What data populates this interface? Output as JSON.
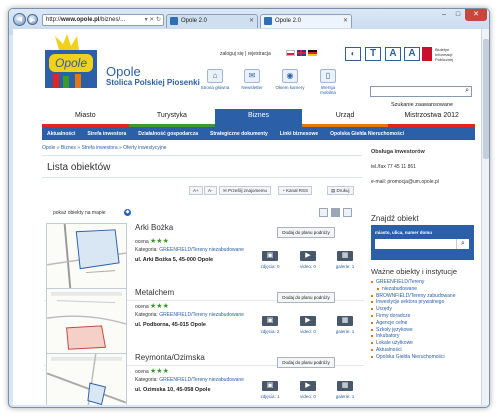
{
  "browser": {
    "url_prefix": "http://",
    "url_host": "www.opole.pl",
    "url_rest": "/biznes/...",
    "tabs": [
      {
        "label": "Opole 2.0"
      },
      {
        "label": "Opole 2.0"
      }
    ]
  },
  "header": {
    "logo_text": "Opole",
    "title": "Opole",
    "subtitle": "Stolica Polskiej Piosenki",
    "login_link": "zaloguj się | rejestracja",
    "quick_links": [
      {
        "label": "Strona główna",
        "icon": "home-icon"
      },
      {
        "label": "Newsletter",
        "icon": "mail-icon"
      },
      {
        "label": "Okiem kamery",
        "icon": "camera-icon"
      },
      {
        "label": "Wersja mobilna",
        "icon": "mobile-icon"
      }
    ],
    "text_size_buttons": [
      "T",
      "A",
      "A"
    ],
    "bip_text": "Biuletyn\nInformacji\nPublicznej",
    "search_placeholder": "",
    "advanced_search": "Szukanie zaawansowane"
  },
  "menu": {
    "items": [
      {
        "label": "Miasto",
        "color": "#e2261c"
      },
      {
        "label": "Turystyka",
        "color": "#3a9a2a"
      },
      {
        "label": "Biznes",
        "color": "#2b5fa8"
      },
      {
        "label": "Urząd",
        "color": "#e07a10"
      },
      {
        "label": "Mistrzostwa 2012",
        "color": "#e2261c"
      }
    ],
    "active_index": 2
  },
  "submenu": {
    "items": [
      "Aktualności",
      "Strefa inwestora",
      "Działalność gospodarcza",
      "Strategiczne dokumenty",
      "Linki biznesowe",
      "Opolska Giełda Nieruchomości"
    ]
  },
  "breadcrumb": "Opole » Biznes » Strefa inwestora » Oferty inwestycyjne",
  "main": {
    "title": "Lista obiektów",
    "toolbar": {
      "font_plus": "A+",
      "font_minus": "A-",
      "share": "Prześlij znajomemu",
      "rss": "Kanał RSS",
      "print": "Drukuj"
    },
    "show_on_map": "pokaż obiekty na mapie",
    "items": [
      {
        "name": "Arki Bożka",
        "rating_label": "ocena",
        "stars": "★★★",
        "category_label": "Kategoria:",
        "category": "GREENFIELD/Tereny niezabudowane",
        "address": "ul. Arki Bożka 5, 45-000 Opole",
        "plan_button": "Dodaj do planu podróży",
        "photos": "zdjęcia: 0",
        "video": "video: 0",
        "gallery": "galerie: 1"
      },
      {
        "name": "Metalchem",
        "rating_label": "ocena",
        "stars": "★★★",
        "category_label": "Kategoria:",
        "category": "GREENFIELD/Tereny niezabudowane",
        "address": "ul. Podborna, 45-015 Opole",
        "plan_button": "Dodaj do planu podróży",
        "photos": "zdjęcia: 2",
        "video": "video: 0",
        "gallery": "galerie: 1"
      },
      {
        "name": "Reymonta/Ozimska",
        "rating_label": "ocena",
        "stars": "★★★",
        "category_label": "Kategoria:",
        "category": "GREENFIELD/Tereny niezabudowane",
        "address": "ul. Ozimska 10, 45-058 Opole",
        "plan_button": "Dodaj do planu podróży",
        "photos": "zdjęcia: 1",
        "video": "video: 0",
        "gallery": "galerie: 1"
      }
    ]
  },
  "sidebar": {
    "service_title": "Obsługa inwestorów",
    "phone": "tel./fax 77 45 11 861",
    "email": "e-mail: promocja@um.opole.pl",
    "find_title": "Znajdź obiekt",
    "find_label": "miasto, ulica, numer domu",
    "important_title": "Ważne obiekty i instytucje",
    "links": [
      {
        "label": "GREENFIELD/Tereny",
        "indent": false
      },
      {
        "label": "niezabudowane",
        "indent": true
      },
      {
        "label": "BROWNFIELD/Tereny zabudowane",
        "indent": false
      },
      {
        "label": "Inwestycje sektora prywatnego",
        "indent": false
      },
      {
        "label": "Urzędy",
        "indent": false
      },
      {
        "label": "Firmy doradcze",
        "indent": false
      },
      {
        "label": "Agencje celne",
        "indent": false
      },
      {
        "label": "Szkoły językowe",
        "indent": false
      },
      {
        "label": "Inkubatory",
        "indent": false
      },
      {
        "label": "Lokale użytkowe",
        "indent": false
      },
      {
        "label": "Aktualności",
        "indent": false
      },
      {
        "label": "Opolska Giełda Nieruchomości",
        "indent": false
      }
    ]
  }
}
